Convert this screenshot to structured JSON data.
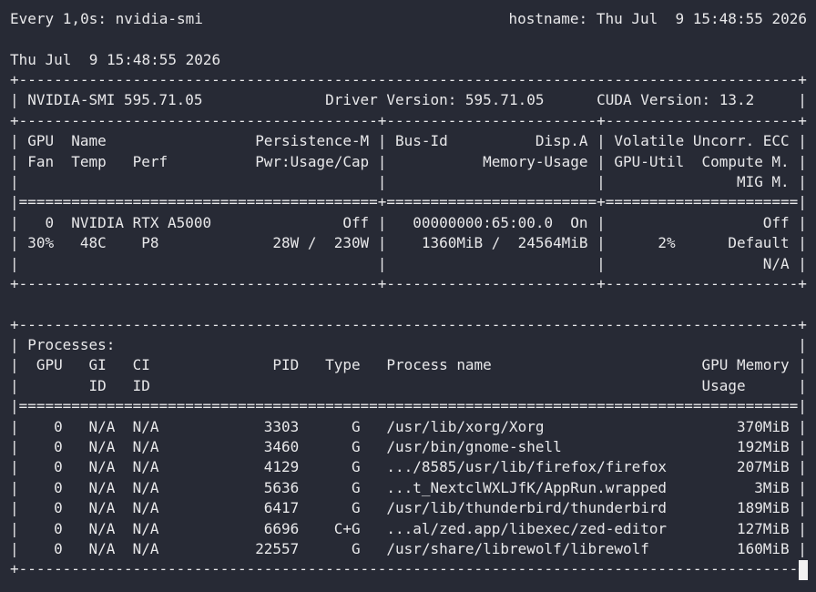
{
  "header": {
    "command": "Every 1,0s: nvidia-smi",
    "host_time": "hostname: Thu Jul  9 15:48:55 2026"
  },
  "timestamp": "Thu Jul  9 15:48:55 2026",
  "smi_lines": [
    "+-----------------------------------------------------------------------------------------+",
    "| NVIDIA-SMI 595.71.05              Driver Version: 595.71.05      CUDA Version: 13.2     |",
    "+-----------------------------------------+------------------------+----------------------+",
    "| GPU  Name                 Persistence-M | Bus-Id          Disp.A | Volatile Uncorr. ECC |",
    "| Fan  Temp   Perf          Pwr:Usage/Cap |           Memory-Usage | GPU-Util  Compute M. |",
    "|                                         |                        |               MIG M. |",
    "|=========================================+========================+======================|",
    "|   0  NVIDIA RTX A5000               Off |   00000000:65:00.0  On |                  Off |",
    "| 30%   48C    P8             28W /  230W |    1360MiB /  24564MiB |      2%      Default |",
    "|                                         |                        |                  N/A |",
    "+-----------------------------------------+------------------------+----------------------+",
    "",
    "+-----------------------------------------------------------------------------------------+",
    "| Processes:                                                                              |",
    "|  GPU   GI   CI              PID   Type   Process name                        GPU Memory |",
    "|        ID   ID                                                               Usage      |",
    "|=========================================================================================|",
    "|    0   N/A  N/A            3303      G   /usr/lib/xorg/Xorg                      370MiB |",
    "|    0   N/A  N/A            3460      G   /usr/bin/gnome-shell                    192MiB |",
    "|    0   N/A  N/A            4129      G   .../8585/usr/lib/firefox/firefox        207MiB |",
    "|    0   N/A  N/A            5636      G   ...t_NextclWXLJfK/AppRun.wrapped          3MiB |",
    "|    0   N/A  N/A            6417      G   /usr/lib/thunderbird/thunderbird        189MiB |",
    "|    0   N/A  N/A            6696    C+G   ...al/zed.app/libexec/zed-editor        127MiB |",
    "|    0   N/A  N/A           22557      G   /usr/share/librewolf/librewolf          160MiB |",
    "+-----------------------------------------------------------------------------------------+"
  ]
}
